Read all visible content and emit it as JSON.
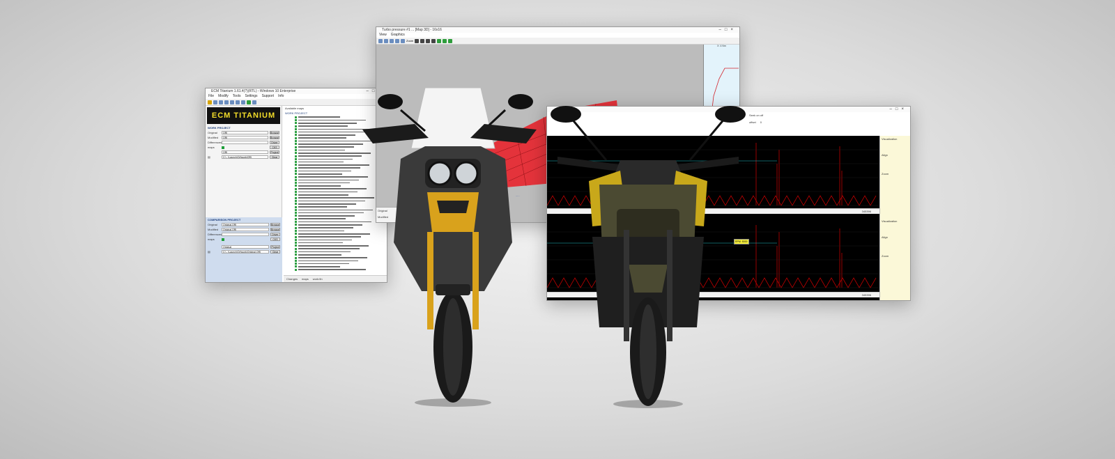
{
  "ecm_window": {
    "title": "ECM Titanium 1.61.4(?)(RTL) - Windows 10 Enterprise",
    "menu": [
      "File",
      "Modify",
      "Tools",
      "Settings",
      "Support",
      "Info"
    ],
    "logo": "ECM TITANIUM",
    "work_project_label": "WORK PROJECT",
    "original_label": "Original",
    "original_value": "ORI",
    "modified_label": "Modified",
    "modified_value": "ORI",
    "differences_label": "Differences",
    "maps_label": "maps",
    "browse_label": "Browse",
    "driver_label": "Driver",
    "checksum_label": "CKS",
    "project_label": "Project",
    "path_value": "C:\\...\\Launch\\Ori\\work\\ORI",
    "clear_label": "Clear",
    "comparison_project_label": "COMPARISON PROJECT",
    "comp_original_value": "Original.ORI",
    "comp_modified_value": "Original.ORI",
    "comp_path_value": "C:\\...\\Launch\\Ori\\work\\Original.ORI",
    "tree_title": "Available maps",
    "tree_subtitle": "WORK PROJECT",
    "status_changes": "Changes",
    "status_maps": "maps",
    "status_work": "work:fin"
  },
  "map3d_window": {
    "title": "Turbo pressure #1 ... [Map 3D] - 16x16",
    "menu": [
      "View",
      "Graphics"
    ],
    "zoom_label": "Zoom",
    "original_label": "Original",
    "modified_label": "Modified",
    "side_graph_label": "X: 4 Nm",
    "side_graph_label2": "Y: 1.00 bar/rpm",
    "hover_text": "Histories of the Driver",
    "max_bounds": "Max bounds"
  },
  "log_window": {
    "search_label": "Seek on off",
    "offset_label": "offset",
    "offset_value": "0",
    "visualization_label": "Visualization",
    "align_label": "Align",
    "zoom_label": "Zoom",
    "readout_value": "RPM: 5000",
    "counter_value": "345396"
  },
  "colors": {
    "map_surface": "#e8242c",
    "log_trace": "#c00000",
    "log_background": "#000000",
    "logo_text": "#f3dd2a",
    "bike_accent_gold": "#d9a21c",
    "bike_body_olive": "#4b4a32"
  },
  "icons": [
    "folder-icon",
    "save-icon",
    "search-icon",
    "zoom-in-icon",
    "zoom-out-icon",
    "rotate-icon",
    "plus-icon"
  ]
}
